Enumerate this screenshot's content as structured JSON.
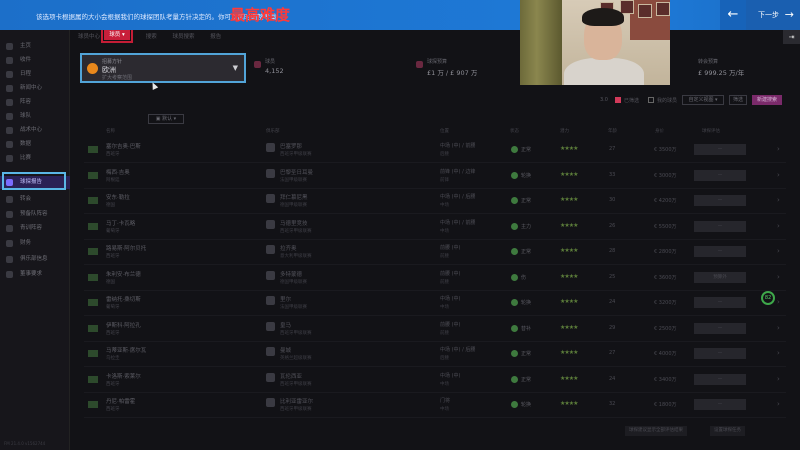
{
  "banner": {
    "text": "该选项卡根据属的大小会根据我们的球探团队考量方针决定的。你可以随时调整考量",
    "highlight": "最高难度",
    "prev_icon": "←",
    "next_label": "下一步",
    "next_icon": "→"
  },
  "sidebar": {
    "items": [
      {
        "label": "主页"
      },
      {
        "label": "收件"
      },
      {
        "label": "日程"
      },
      {
        "label": "新闻中心"
      },
      {
        "label": "阵容"
      },
      {
        "label": "球队"
      },
      {
        "label": "战术中心"
      },
      {
        "label": "数据"
      },
      {
        "label": "比赛"
      },
      {
        "label": "球探报告"
      },
      {
        "label": "转会"
      },
      {
        "label": "预备队阵容"
      },
      {
        "label": "青训阵容"
      },
      {
        "label": "财务"
      },
      {
        "label": "俱乐部信息"
      },
      {
        "label": "董事要求"
      }
    ],
    "active_index": 9
  },
  "crumbs": [
    "球员中心",
    "球员",
    "搜索",
    "球员搜索",
    "报告"
  ],
  "filter_tab": "球员 ▾",
  "difficulty": {
    "label": "招募方针",
    "value": "欧洲",
    "sub": "扩大考察范围",
    "caret": "▼"
  },
  "kpis": [
    {
      "label": "球员",
      "value": "4,152"
    },
    {
      "label": "球探预算",
      "value": "£1 万 / £ 907 万"
    },
    {
      "label": "转会预算",
      "value": "£ 999.25 万/年"
    }
  ],
  "toolbar": {
    "check1": "已筛选",
    "check2": "我的球员",
    "btn_view": "自定义视图 ▾",
    "btn_small": "筛选",
    "btn_primary": "新建搜索"
  },
  "table_header": [
    "名称",
    "俱乐部",
    "位置",
    "状态",
    "潜力",
    "年龄",
    "身价",
    "球探评估"
  ],
  "rows": [
    {
      "name": "塞尔吉奥·巴斯",
      "sub": "西班牙",
      "club": "巴塞罗那",
      "league": "西班牙甲级联赛",
      "pos": "中场 (中) / 前腰",
      "pos2": "后腰",
      "stat": "正常",
      "stars": "★★★★",
      "age": "27",
      "value": "€ 3500万",
      "bar": "—"
    },
    {
      "name": "梅西·吉奥",
      "sub": "阿根廷",
      "club": "巴黎圣日耳曼",
      "league": "法国甲级联赛",
      "pos": "前锋 (中) / 边锋",
      "pos2": "前锋",
      "stat": "轮换",
      "stars": "★★★★",
      "age": "33",
      "value": "€ 3000万",
      "bar": "—"
    },
    {
      "name": "安东·勒拉",
      "sub": "德国",
      "club": "拜仁慕尼黑",
      "league": "德国甲级联赛",
      "pos": "中场 (中) / 后腰",
      "pos2": "中场",
      "stat": "正常",
      "stars": "★★★★",
      "age": "30",
      "value": "€ 4200万",
      "bar": "—"
    },
    {
      "name": "马丁·卡瓦略",
      "sub": "葡萄牙",
      "club": "马德里竞技",
      "league": "西班牙甲级联赛",
      "pos": "中场 (中) / 前腰",
      "pos2": "中场",
      "stat": "主力",
      "stars": "★★★★",
      "age": "26",
      "value": "€ 5500万",
      "bar": "—"
    },
    {
      "name": "路易斯·阿尔贝托",
      "sub": "西班牙",
      "club": "拉齐奥",
      "league": "意大利甲级联赛",
      "pos": "前腰 (中)",
      "pos2": "前腰",
      "stat": "正常",
      "stars": "★★★★",
      "age": "28",
      "value": "€ 2800万",
      "bar": "—"
    },
    {
      "name": "朱利安·布兰德",
      "sub": "德国",
      "club": "多特蒙德",
      "league": "德国甲级联赛",
      "pos": "前腰 (中)",
      "pos2": "前腰",
      "stat": "伤",
      "stars": "★★★★",
      "age": "25",
      "value": "€ 3600万",
      "bar": "预算外"
    },
    {
      "name": "雷纳托·桑切斯",
      "sub": "葡萄牙",
      "club": "里尔",
      "league": "法国甲级联赛",
      "pos": "中场 (中)",
      "pos2": "中场",
      "stat": "轮换",
      "stars": "★★★★",
      "age": "24",
      "value": "€ 3200万",
      "bar": "—"
    },
    {
      "name": "伊斯科·阿拉孔",
      "sub": "西班牙",
      "club": "皇马",
      "league": "西班牙甲级联赛",
      "pos": "前腰 (中)",
      "pos2": "前腰",
      "stat": "替补",
      "stars": "★★★★",
      "age": "29",
      "value": "€ 2500万",
      "bar": "—"
    },
    {
      "name": "马蒂亚斯·席尔瓦",
      "sub": "乌拉圭",
      "club": "曼城",
      "league": "英格兰超级联赛",
      "pos": "中场 (中) / 后腰",
      "pos2": "后腰",
      "stat": "正常",
      "stars": "★★★★",
      "age": "27",
      "value": "€ 4000万",
      "bar": "—"
    },
    {
      "name": "卡洛斯·索莱尔",
      "sub": "西班牙",
      "club": "瓦伦西亚",
      "league": "西班牙甲级联赛",
      "pos": "中场 (中)",
      "pos2": "中场",
      "stat": "正常",
      "stars": "★★★★",
      "age": "24",
      "value": "€ 3400万",
      "bar": "—"
    },
    {
      "name": "丹尼·帕雷霍",
      "sub": "西班牙",
      "club": "比利亚雷亚尔",
      "league": "西班牙甲级联赛",
      "pos": "门将",
      "pos2": "中场",
      "stat": "轮换",
      "stars": "★★★★",
      "age": "32",
      "value": "€ 1800万",
      "bar": "—"
    }
  ],
  "score_badge": "82",
  "footer": {
    "btn1": "球探建议显示全部评估结果",
    "btn2": "设置球探任务"
  },
  "version": "FM 21.4.0 v1562744",
  "right_icon": "⇥"
}
